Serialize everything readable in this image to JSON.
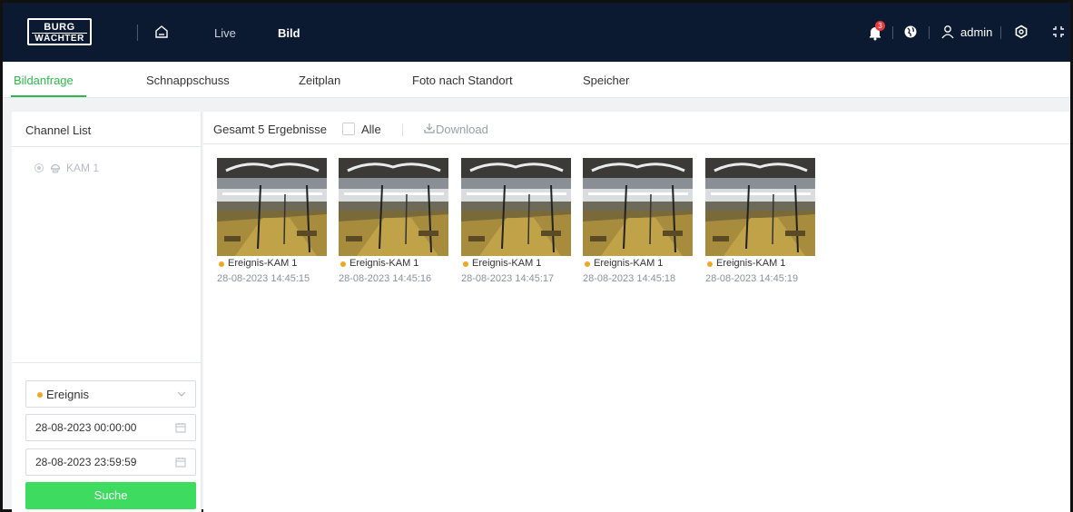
{
  "brand": {
    "line1": "BURG",
    "line2": "WÄCHTER"
  },
  "nav": {
    "live": "Live",
    "bild": "Bild"
  },
  "header": {
    "notification_count": "3",
    "user": "admin"
  },
  "tabs": [
    {
      "label": "Bildanfrage",
      "active": true
    },
    {
      "label": "Schnappschuss",
      "active": false
    },
    {
      "label": "Zeitplan",
      "active": false
    },
    {
      "label": "Foto nach Standort",
      "active": false
    },
    {
      "label": "Speicher",
      "active": false
    }
  ],
  "sidebar": {
    "title": "Channel List",
    "channels": [
      {
        "label": "KAM 1"
      }
    ],
    "filter": {
      "type": "Ereignis",
      "start": "28-08-2023 00:00:00",
      "end": "28-08-2023 23:59:59",
      "search_label": "Suche"
    }
  },
  "results": {
    "summary": "Gesamt 5 Ergebnisse",
    "select_all": "Alle",
    "download": "Download",
    "items": [
      {
        "name": "Ereignis-KAM 1",
        "time": "28-08-2023 14:45:15"
      },
      {
        "name": "Ereignis-KAM 1",
        "time": "28-08-2023 14:45:16"
      },
      {
        "name": "Ereignis-KAM 1",
        "time": "28-08-2023 14:45:17"
      },
      {
        "name": "Ereignis-KAM 1",
        "time": "28-08-2023 14:45:18"
      },
      {
        "name": "Ereignis-KAM 1",
        "time": "28-08-2023 14:45:19"
      }
    ]
  },
  "colors": {
    "header_bg": "#0b1a30",
    "accent": "#2db84d",
    "button": "#3ddb5f",
    "event_dot": "#f0a824",
    "badge": "#e53a3a"
  },
  "icons": [
    "home-icon",
    "bell-icon",
    "globe-icon",
    "user-icon",
    "gear-icon",
    "fullscreen-icon",
    "camera-icon",
    "chevron-down-icon",
    "calendar-icon",
    "download-icon"
  ]
}
